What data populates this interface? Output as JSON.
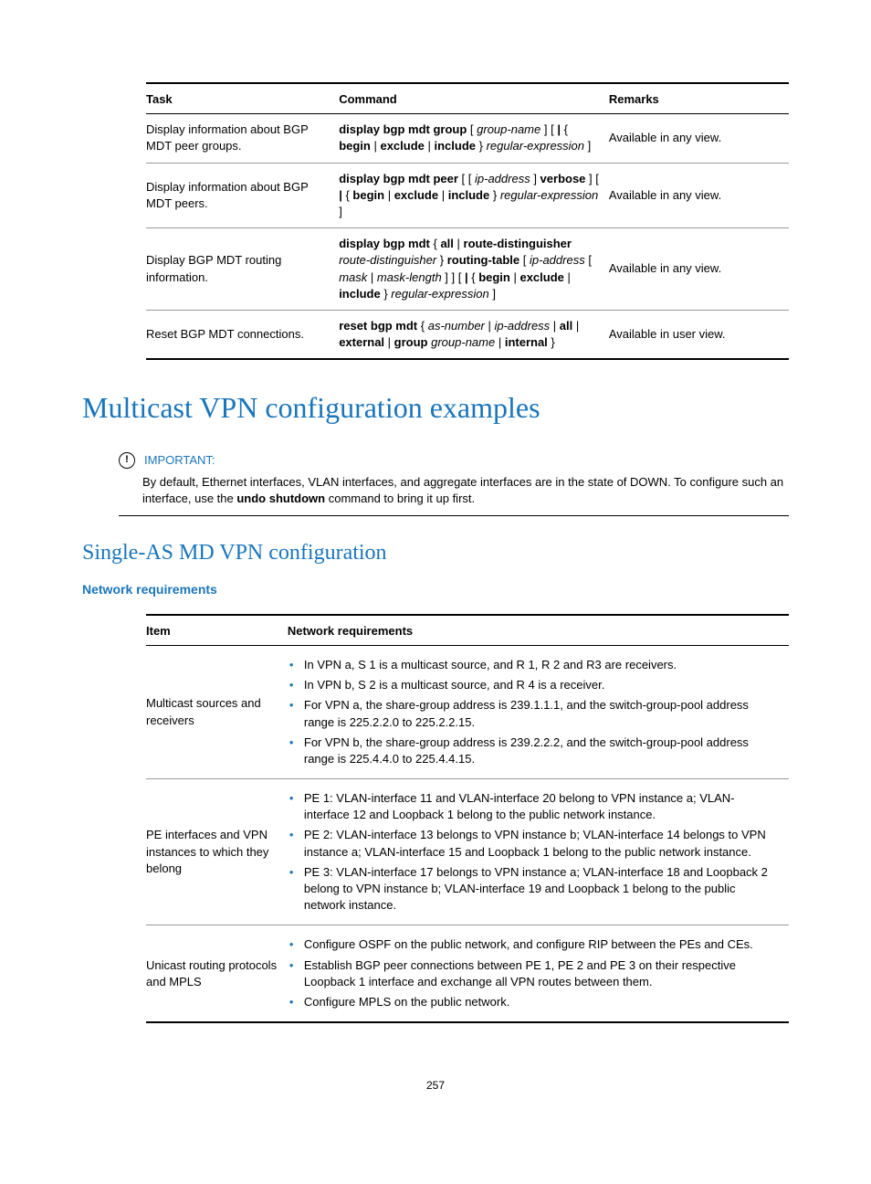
{
  "cmd_table": {
    "headers": {
      "task": "Task",
      "command": "Command",
      "remarks": "Remarks"
    },
    "rows": [
      {
        "task": "Display information about BGP MDT peer groups.",
        "cmd_html": "<span class='b'>display bgp mdt group</span> [ <span class='i'>group-name</span> ] [ <span class='b'>|</span> { <span class='b'>begin</span> | <span class='b'>exclude</span> | <span class='b'>include</span> } <span class='i'>regular-expression</span> ]",
        "remarks": "Available in any view."
      },
      {
        "task": "Display information about BGP MDT peers.",
        "cmd_html": "<span class='b'>display bgp mdt peer</span> [ [ <span class='i'>ip-address</span> ] <span class='b'>verbose</span> ] [ <span class='b'>|</span> { <span class='b'>begin</span> | <span class='b'>exclude</span> | <span class='b'>include</span> } <span class='i'>regular-expression</span> ]",
        "remarks": "Available in any view."
      },
      {
        "task": "Display BGP MDT routing information.",
        "cmd_html": "<span class='b'>display bgp mdt</span> { <span class='b'>all</span> | <span class='b'>route-distinguisher</span> <span class='i'>route-distinguisher</span> } <span class='b'>routing-table</span> [ <span class='i'>ip-address</span> [ <span class='i'>mask</span> | <span class='i'>mask-length</span> ] ] [ <span class='b'>|</span> { <span class='b'>begin</span> | <span class='b'>exclude</span> | <span class='b'>include</span> } <span class='i'>regular-expression</span> ]",
        "remarks": "Available in any view."
      },
      {
        "task": "Reset BGP MDT connections.",
        "cmd_html": "<span class='b'>reset bgp mdt</span> { <span class='i'>as-number</span> | <span class='i'>ip-address</span> | <span class='b'>all</span> | <span class='b'>external</span> | <span class='b'>group</span> <span class='i'>group-name</span> | <span class='b'>internal</span> }",
        "remarks": "Available in user view."
      }
    ]
  },
  "h1": "Multicast VPN configuration examples",
  "callout": {
    "label": "IMPORTANT:",
    "body_html": "By default, Ethernet interfaces, VLAN interfaces, and aggregate interfaces are in the state of DOWN. To configure such an interface, use the <span class='b'>undo shutdown</span> command to bring it up first."
  },
  "h2": "Single-AS MD VPN configuration",
  "h3": "Network requirements",
  "req_table": {
    "headers": {
      "item": "Item",
      "req": "Network requirements"
    },
    "rows": [
      {
        "item": "Multicast sources and receivers",
        "bullets": [
          "In VPN a, S 1 is a multicast source, and R 1, R 2 and R3 are receivers.",
          "In VPN b, S 2 is a multicast source, and R 4 is a receiver.",
          "For VPN a, the share-group address is 239.1.1.1, and the switch-group-pool address range is 225.2.2.0 to 225.2.2.15.",
          "For VPN b, the share-group address is 239.2.2.2, and the switch-group-pool address range is 225.4.4.0 to 225.4.4.15."
        ]
      },
      {
        "item": "PE interfaces and VPN instances to which they belong",
        "bullets": [
          "PE 1: VLAN-interface 11 and VLAN-interface 20 belong to VPN instance a; VLAN-interface 12 and Loopback 1 belong to the public network instance.",
          "PE 2: VLAN-interface 13 belongs to VPN instance b; VLAN-interface 14 belongs to VPN instance a; VLAN-interface 15 and Loopback 1 belong to the public network instance.",
          "PE 3: VLAN-interface 17 belongs to VPN instance a; VLAN-interface 18 and Loopback 2 belong to VPN instance b; VLAN-interface 19 and Loopback 1 belong to the public network instance."
        ]
      },
      {
        "item": "Unicast routing protocols and MPLS",
        "bullets": [
          "Configure OSPF on the public network, and configure RIP between the PEs and CEs.",
          "Establish BGP peer connections between PE 1, PE 2 and PE 3 on their respective Loopback 1 interface and exchange all VPN routes between them.",
          "Configure MPLS on the public network."
        ]
      }
    ]
  },
  "page_number": "257"
}
